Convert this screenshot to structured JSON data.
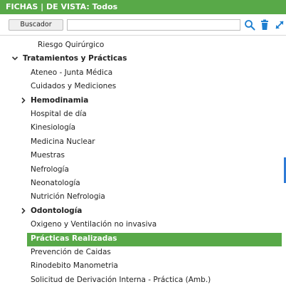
{
  "header": {
    "title": "FICHAS | DE VISTA: Todos"
  },
  "toolbar": {
    "search_button_label": "Buscador",
    "search_value": "",
    "search_placeholder": "",
    "icons": [
      "search-icon",
      "trash-icon",
      "expand-icon"
    ],
    "accent": "#1e7fd0"
  },
  "tree": {
    "items": [
      {
        "label": "Riesgo Quirúrgico",
        "bold": false,
        "toggle": "none",
        "selected": false
      },
      {
        "label": "Tratamientos y Prácticas",
        "bold": true,
        "toggle": "expanded",
        "selected": false
      },
      {
        "label": "Ateneo - Junta Médica",
        "bold": false,
        "toggle": "none",
        "selected": false
      },
      {
        "label": "Cuidados y Mediciones",
        "bold": false,
        "toggle": "none",
        "selected": false
      },
      {
        "label": "Hemodinamia",
        "bold": true,
        "toggle": "collapsed",
        "selected": false
      },
      {
        "label": "Hospital de día",
        "bold": false,
        "toggle": "none",
        "selected": false
      },
      {
        "label": "Kinesiología",
        "bold": false,
        "toggle": "none",
        "selected": false
      },
      {
        "label": "Medicina Nuclear",
        "bold": false,
        "toggle": "none",
        "selected": false
      },
      {
        "label": "Muestras",
        "bold": false,
        "toggle": "none",
        "selected": false
      },
      {
        "label": "Nefrología",
        "bold": false,
        "toggle": "none",
        "selected": false
      },
      {
        "label": "Neonatología",
        "bold": false,
        "toggle": "none",
        "selected": false
      },
      {
        "label": "Nutrición Nefrologia",
        "bold": false,
        "toggle": "none",
        "selected": false
      },
      {
        "label": "Odontología",
        "bold": true,
        "toggle": "collapsed",
        "selected": false
      },
      {
        "label": "Oxigeno y Ventilación no invasiva",
        "bold": false,
        "toggle": "none",
        "selected": false
      },
      {
        "label": "Prácticas Realizadas",
        "bold": true,
        "toggle": "none",
        "selected": true
      },
      {
        "label": "Prevención de Caidas",
        "bold": false,
        "toggle": "none",
        "selected": false
      },
      {
        "label": "Rinodebito Manometria",
        "bold": false,
        "toggle": "none",
        "selected": false
      },
      {
        "label": "Solicitud de Derivación Interna - Práctica (Amb.)",
        "bold": false,
        "toggle": "none",
        "selected": false
      }
    ]
  },
  "colors": {
    "header_bg": "#58a948",
    "selected_bg": "#58a948",
    "scroll_indicator": "#2f7ad6"
  }
}
